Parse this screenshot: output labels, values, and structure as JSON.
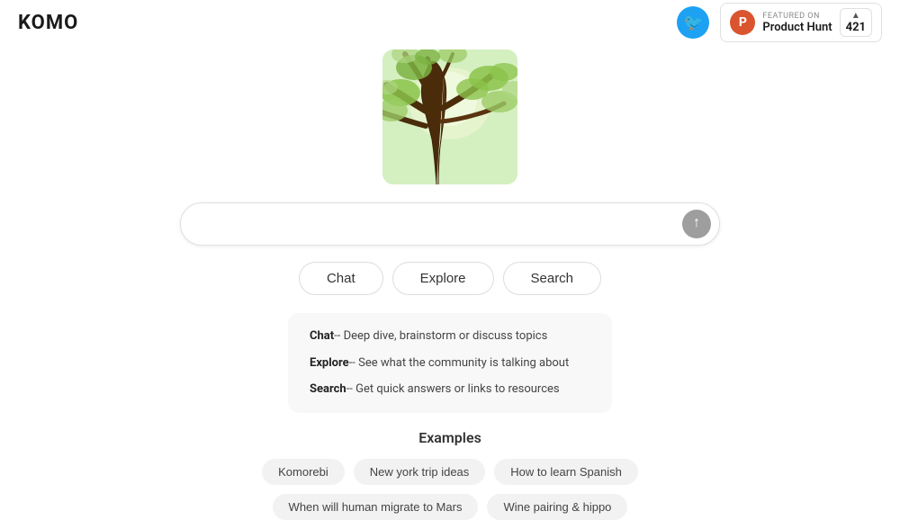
{
  "header": {
    "logo": "KOMO",
    "twitter_label": "Twitter",
    "producthunt": {
      "featured_on": "FEATURED ON",
      "name": "Product Hunt",
      "count": "421"
    }
  },
  "search": {
    "placeholder": "",
    "submit_label": "Submit"
  },
  "modes": {
    "chat_label": "Chat",
    "explore_label": "Explore",
    "search_label": "Search"
  },
  "info": {
    "chat_label": "Chat",
    "chat_desc": "-- Deep dive, brainstorm or discuss topics",
    "explore_label": "Explore",
    "explore_desc": "-- See what the community is talking about",
    "search_label": "Search",
    "search_desc": "-- Get quick answers or links to resources"
  },
  "examples": {
    "title": "Examples",
    "chips_row1": [
      "Komorebi",
      "New york trip ideas",
      "How to learn Spanish"
    ],
    "chips_row2": [
      "When will human migrate to Mars",
      "Wine pairing & hippo"
    ]
  }
}
